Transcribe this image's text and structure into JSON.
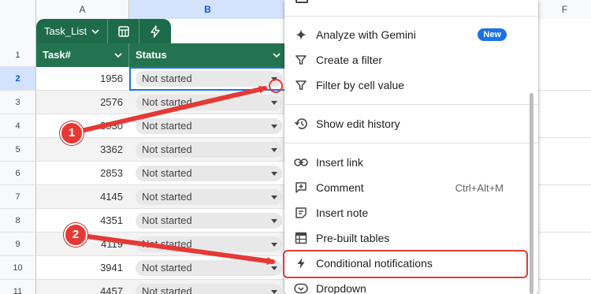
{
  "columns": [
    "A",
    "B",
    "F"
  ],
  "rows": [
    "1",
    "2",
    "3",
    "4",
    "5",
    "6",
    "7",
    "8",
    "9",
    "10",
    "11"
  ],
  "table": {
    "name": "Task_List",
    "headers": {
      "task": "Task#",
      "status": "Status"
    },
    "records": [
      {
        "task": "1956",
        "status": "Not started"
      },
      {
        "task": "2576",
        "status": "Not started"
      },
      {
        "task": "3530",
        "status": "Not started"
      },
      {
        "task": "3362",
        "status": "Not started"
      },
      {
        "task": "2853",
        "status": "Not started"
      },
      {
        "task": "4145",
        "status": "Not started"
      },
      {
        "task": "4351",
        "status": "Not started"
      },
      {
        "task": "4119",
        "status": "Not started"
      },
      {
        "task": "3941",
        "status": "Not started"
      },
      {
        "task": "4457",
        "status": "Not started"
      }
    ]
  },
  "menu": {
    "items": [
      {
        "label": "Analyze with Gemini",
        "icon": "sparkle-icon",
        "badge": "New"
      },
      {
        "label": "Create a filter",
        "icon": "filter-icon"
      },
      {
        "label": "Filter by cell value",
        "icon": "filter-icon"
      },
      {
        "label": "Show edit history",
        "icon": "history-icon"
      },
      {
        "label": "Insert link",
        "icon": "link-icon"
      },
      {
        "label": "Comment",
        "icon": "comment-icon",
        "shortcut": "Ctrl+Alt+M"
      },
      {
        "label": "Insert note",
        "icon": "note-icon"
      },
      {
        "label": "Pre-built tables",
        "icon": "table-icon"
      },
      {
        "label": "Conditional notifications",
        "icon": "bolt-icon"
      },
      {
        "label": "Dropdown",
        "icon": "dropdown-icon"
      }
    ]
  },
  "annotations": {
    "callout_1": "1",
    "callout_2": "2"
  },
  "colors": {
    "table_green": "#1e6b4a",
    "accent_blue": "#1a73e8",
    "annotation_red": "#e53935"
  }
}
